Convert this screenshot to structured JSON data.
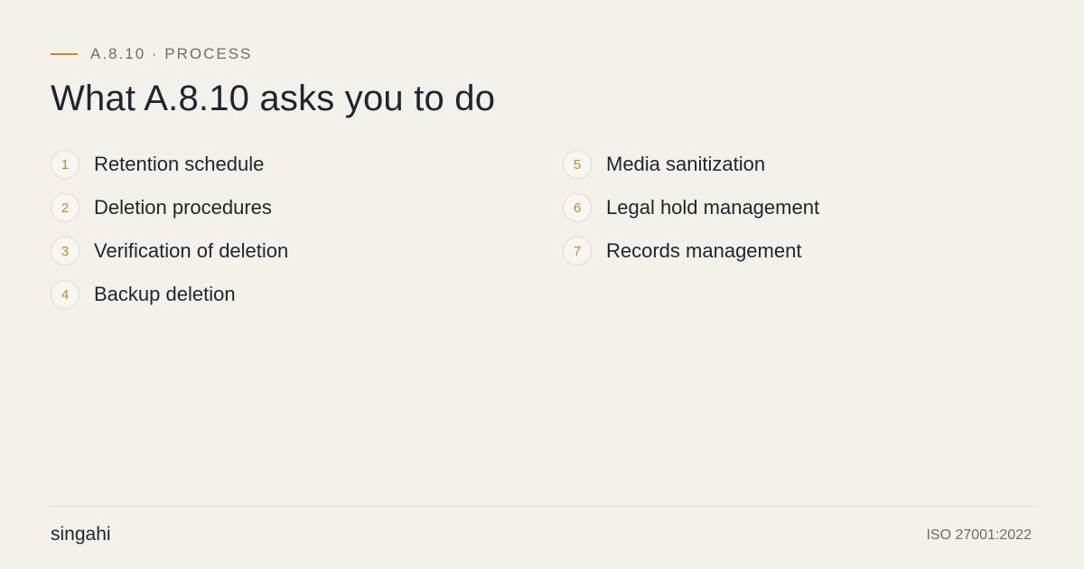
{
  "header": {
    "eyebrow": "A.8.10 · PROCESS",
    "title": "What A.8.10 asks you to do"
  },
  "steps": [
    {
      "num": "1",
      "label": "Retention schedule"
    },
    {
      "num": "2",
      "label": "Deletion procedures"
    },
    {
      "num": "3",
      "label": "Verification of deletion"
    },
    {
      "num": "4",
      "label": "Backup deletion"
    },
    {
      "num": "5",
      "label": "Media sanitization"
    },
    {
      "num": "6",
      "label": "Legal hold management"
    },
    {
      "num": "7",
      "label": "Records management"
    }
  ],
  "footer": {
    "brand": "singahi",
    "standard": "ISO 27001:2022"
  },
  "colors": {
    "background": "#f4f1ea",
    "accent": "#c08a2e",
    "text": "#1c2530",
    "muted": "#6f6c66"
  }
}
